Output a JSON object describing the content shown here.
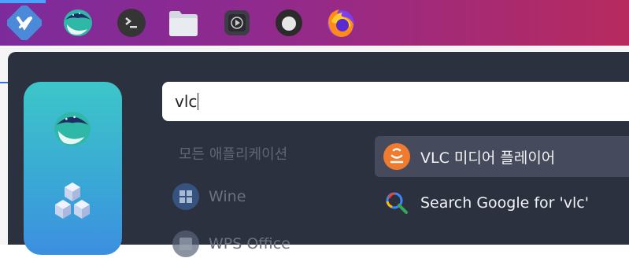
{
  "taskbar": {
    "apps": [
      "launcher-icon",
      "whale-browser-icon",
      "terminal-icon",
      "files-icon",
      "media-player-icon",
      "obs-icon",
      "firefox-icon"
    ]
  },
  "launcher": {
    "search": {
      "value": "vlc"
    },
    "category_title": "모든 애플리케이션",
    "app_list": [
      {
        "label": "Wine",
        "icon": "wine-icon"
      },
      {
        "label": "WPS Office",
        "icon": "wps-office-icon"
      }
    ],
    "results": [
      {
        "label": "VLC 미디어 플레이어",
        "icon": "vlc-icon",
        "selected": true
      },
      {
        "label": "Search Google for 'vlc'",
        "icon": "search-icon",
        "selected": false
      }
    ],
    "sidebar": [
      "whale-browser-icon",
      "apps-cube-icon"
    ]
  },
  "colors": {
    "panel": "#2c3140",
    "selected": "#454b5c",
    "accent": "#3dc6c9"
  }
}
